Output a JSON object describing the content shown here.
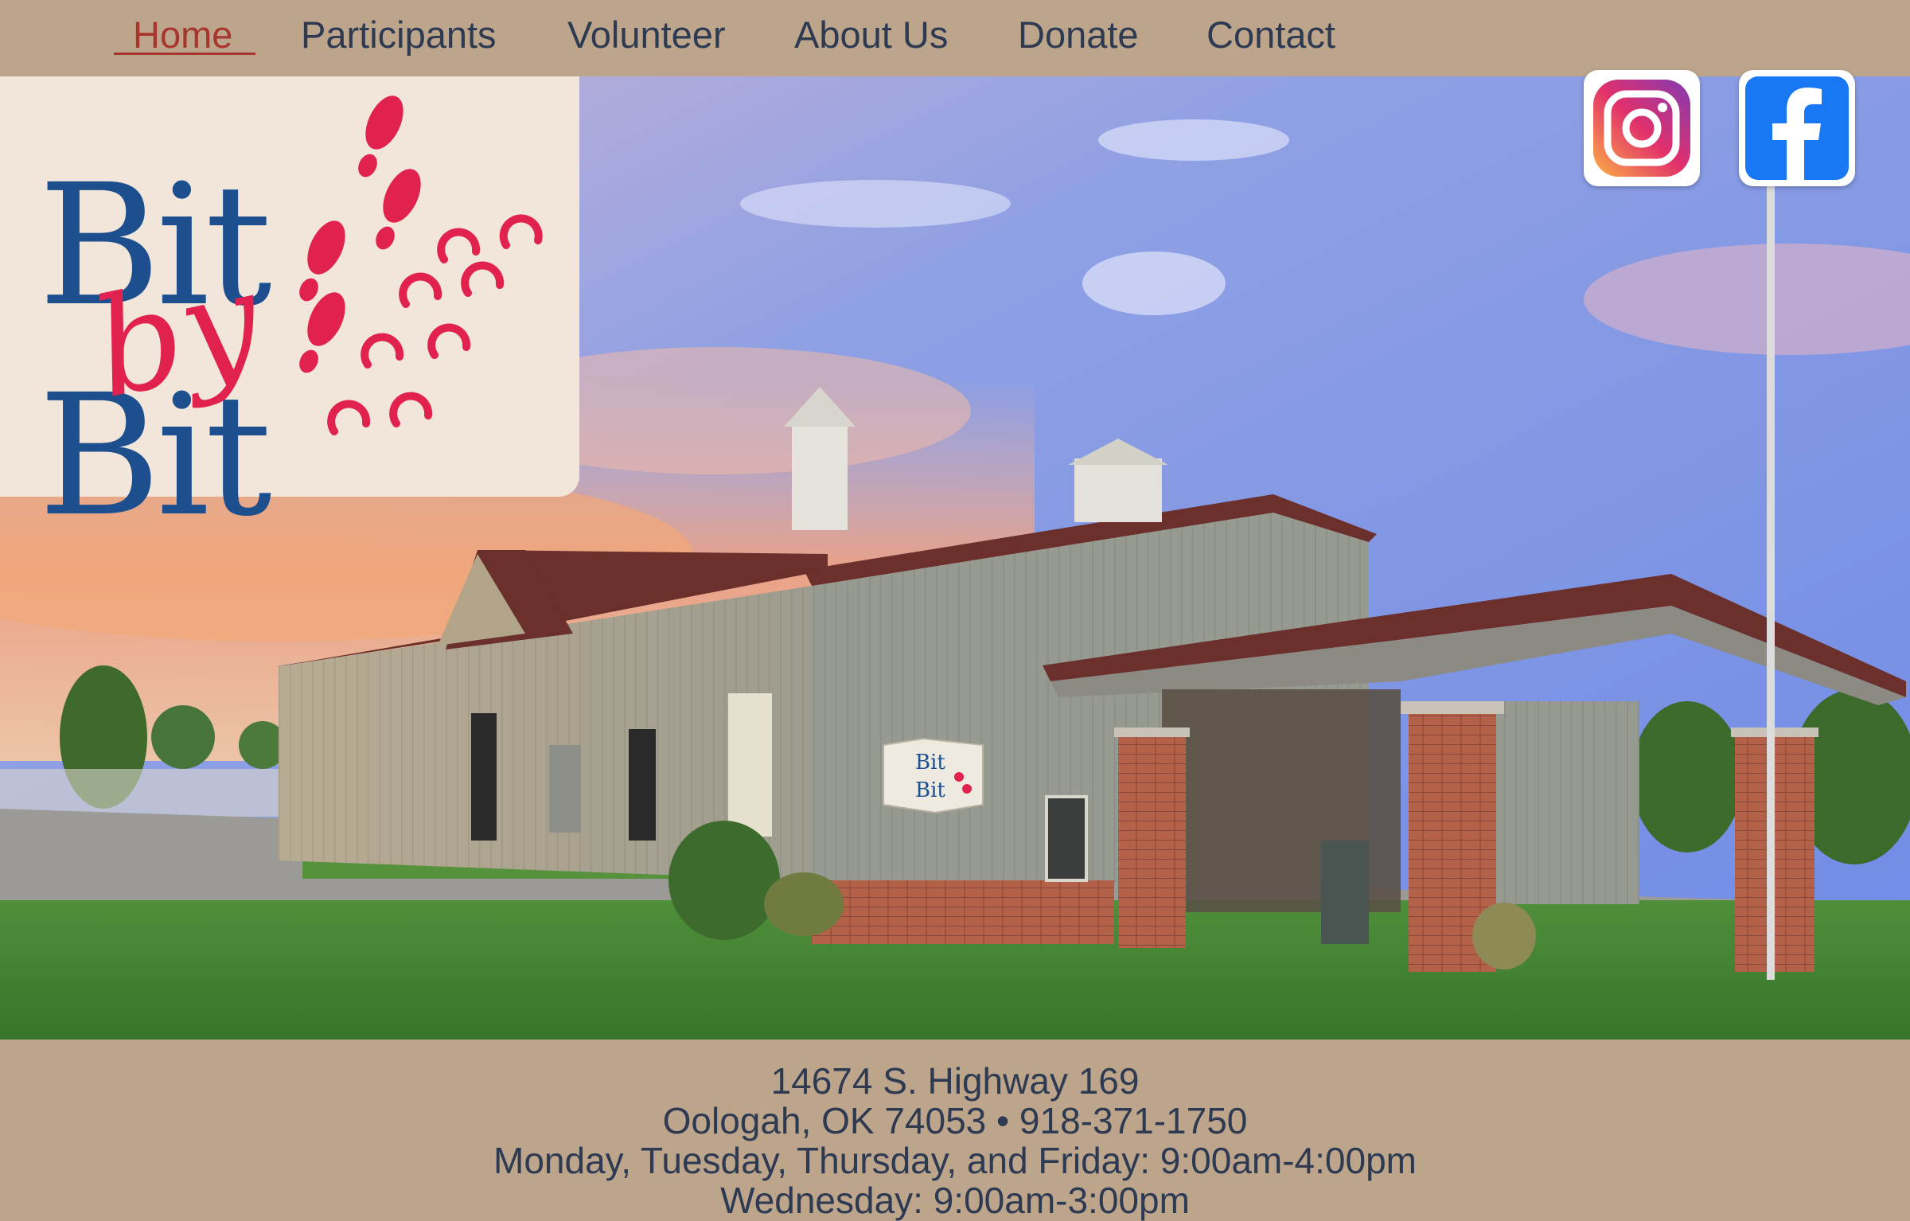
{
  "nav": {
    "items": [
      {
        "label": "Home",
        "active": true
      },
      {
        "label": "Participants"
      },
      {
        "label": "Volunteer"
      },
      {
        "label": "About Us"
      },
      {
        "label": "Donate"
      },
      {
        "label": "Contact"
      }
    ]
  },
  "logo": {
    "line1": "Bit",
    "line2": "by",
    "line3": "Bit",
    "colors": {
      "blue": "#1d4f8f",
      "red": "#e2224e"
    }
  },
  "social": {
    "instagram_icon": "instagram-icon",
    "facebook_icon": "facebook-icon"
  },
  "hero": {
    "sign_text_1": "Bit",
    "sign_text_2": "Bit"
  },
  "footer": {
    "address": "14674 S. Highway 169",
    "city_phone": "Oologah, OK 74053  •  918-371-1750",
    "hours": "Monday, Tuesday, Thursday, and Friday: 9:00am-4:00pm",
    "hours_partial": "Wednesday: 9:00am-3:00pm"
  },
  "colors": {
    "nav_bg": "#bda58c",
    "nav_text": "#2d3a52",
    "nav_active": "#a7362d",
    "facebook_blue": "#1877f2"
  }
}
